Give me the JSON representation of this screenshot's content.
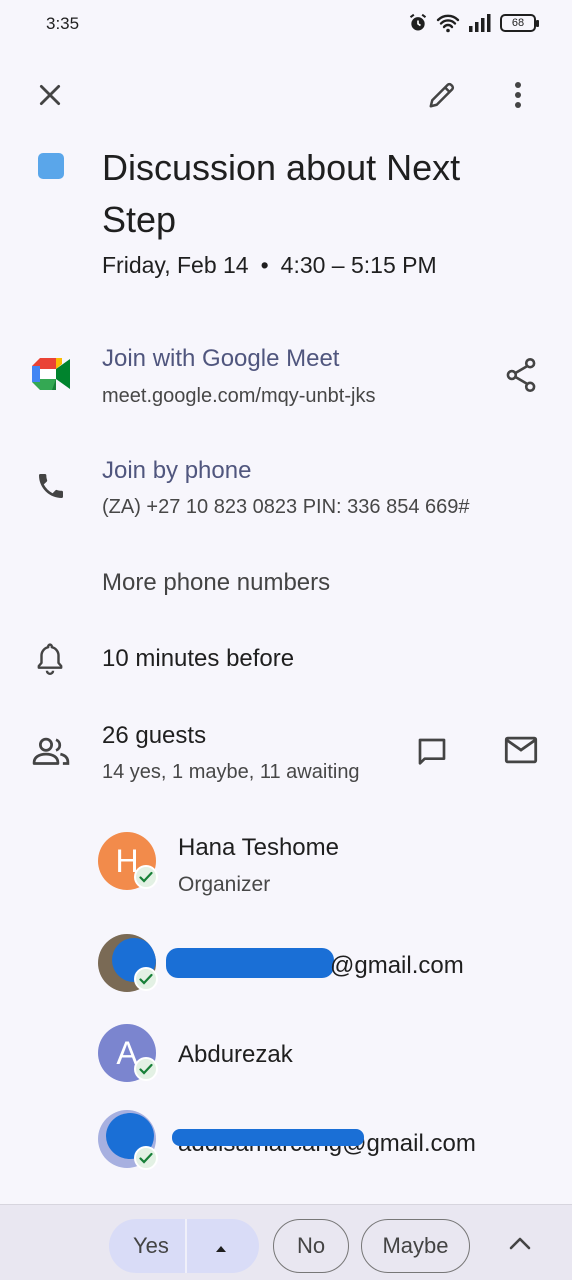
{
  "status_bar": {
    "time": "3:35",
    "battery": "68"
  },
  "event": {
    "title": "Discussion about Next Step",
    "date": "Friday, Feb 14",
    "time_range": "4:30 – 5:15 PM",
    "color": "#5aa6ea"
  },
  "meet": {
    "title": "Join with Google Meet",
    "url": "meet.google.com/mqy-unbt-jks"
  },
  "phone": {
    "title": "Join by phone",
    "detail": "(ZA) +27 10 823 0823 PIN: 336 854 669#",
    "more": "More phone numbers"
  },
  "reminder": {
    "text": "10 minutes before"
  },
  "guests": {
    "count_label": "26 guests",
    "summary": "14 yes, 1 maybe, 11 awaiting",
    "list": [
      {
        "initial": "H",
        "name": "Hana Teshome",
        "role": "Organizer",
        "color": "#f28b4b"
      },
      {
        "initial": "",
        "name": "@gmail.com",
        "role": "",
        "color": "#7a6a55"
      },
      {
        "initial": "A",
        "name": "Abdurezak",
        "role": "",
        "color": "#7b85cf"
      },
      {
        "initial": "",
        "name": "addisamarcang@gmail.com",
        "role": "",
        "color": "#a7b0e0"
      }
    ]
  },
  "rsvp": {
    "yes": "Yes",
    "no": "No",
    "maybe": "Maybe"
  },
  "icons": {
    "close": "close-icon",
    "edit": "pencil-icon",
    "more": "more-vert-icon",
    "share": "share-icon",
    "phone": "phone-icon",
    "bell": "bell-icon",
    "people": "people-icon",
    "chat": "chat-icon",
    "mail": "mail-icon"
  }
}
